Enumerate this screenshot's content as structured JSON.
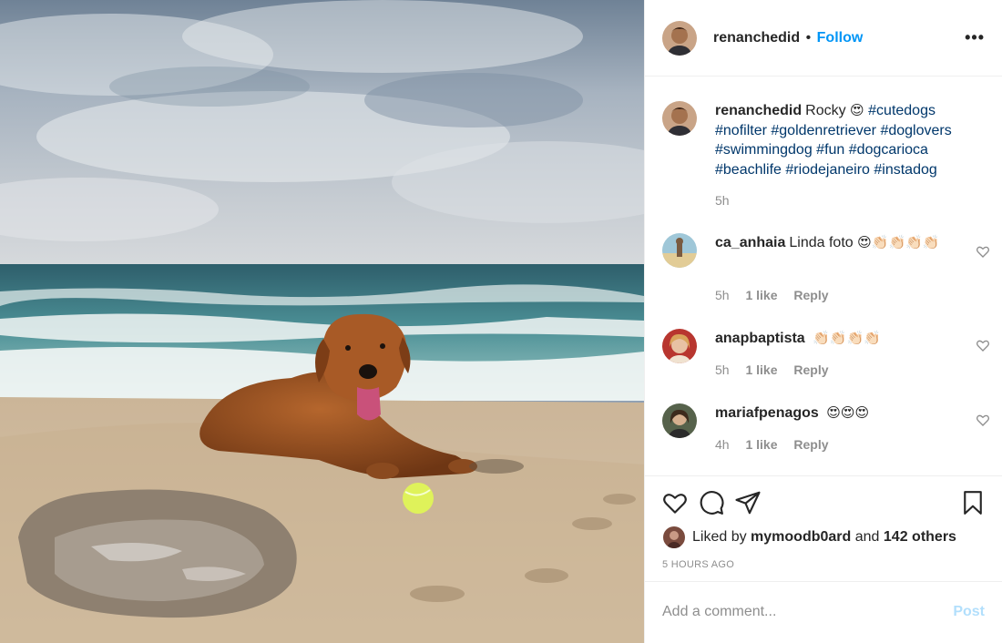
{
  "post": {
    "author": "renanchedid",
    "separator": "•",
    "follow_label": "Follow",
    "more_label": "•••"
  },
  "caption": {
    "username": "renanchedid",
    "text": "Rocky",
    "emoji": "😍",
    "hashtags": [
      "#cutedogs",
      "#nofilter",
      "#goldenretriever",
      "#doglovers",
      "#swimmingdog",
      "#fun",
      "#dogcarioca",
      "#beachlife",
      "#riodejaneiro",
      "#instadog"
    ],
    "time": "5h"
  },
  "comments": [
    {
      "username": "ca_anhaia",
      "text": "Linda foto",
      "emoji": "😍👏🏻👏🏻👏🏻👏🏻",
      "time": "5h",
      "likes": "1 like",
      "reply": "Reply"
    },
    {
      "username": "anapbaptista",
      "text": "",
      "emoji": "👏🏻👏🏻👏🏻👏🏻",
      "time": "5h",
      "likes": "1 like",
      "reply": "Reply"
    },
    {
      "username": "mariafpenagos",
      "text": "",
      "emoji": "😍😍😍",
      "time": "4h",
      "likes": "1 like",
      "reply": "Reply"
    }
  ],
  "likes": {
    "prefix": "Liked by",
    "user": "mymoodb0ard",
    "and": "and",
    "others": "142 others"
  },
  "timestamp": "5 HOURS AGO",
  "add_comment": {
    "placeholder": "Add a comment...",
    "post_label": "Post"
  },
  "icons": {
    "header_avatar": "avatar-icon",
    "like": "heart-icon",
    "comment": "comment-bubble-icon",
    "share": "paper-plane-icon",
    "save": "bookmark-icon",
    "comment_like": "heart-icon"
  },
  "colors": {
    "follow": "#0095f6",
    "hashtag": "#00376b",
    "muted": "#8e8e8e",
    "post_button_disabled": "#b2dffc",
    "border": "#efefef"
  }
}
